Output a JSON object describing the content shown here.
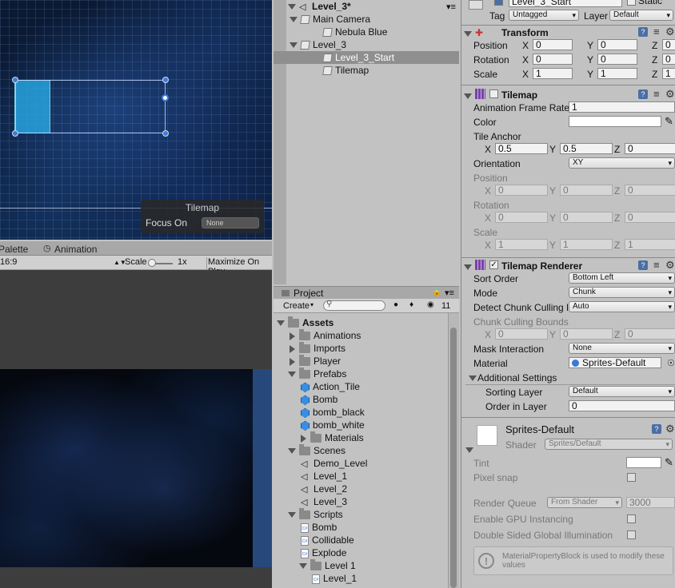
{
  "scene": {
    "overlay_title": "Tilemap",
    "focus_label": "Focus On",
    "focus_value": "None"
  },
  "bottom_tabs": {
    "palette": "Palette",
    "animation": "Animation"
  },
  "game_toolbar": {
    "aspect": "16:9",
    "scale_label": "Scale",
    "scale_value": "1x",
    "maximize": "Maximize On Play"
  },
  "hierarchy": {
    "items": [
      {
        "label": "Level_3*",
        "indent": 0,
        "icon": "unity-scene-icon",
        "expanded": true
      },
      {
        "label": "Main Camera",
        "indent": 1,
        "icon": "cube-icon",
        "expanded": true
      },
      {
        "label": "Nebula Blue",
        "indent": 2,
        "icon": "cube-icon"
      },
      {
        "label": "Level_3",
        "indent": 1,
        "icon": "cube-icon",
        "expanded": true
      },
      {
        "label": "Level_3_Start",
        "indent": 2,
        "icon": "cube-icon",
        "selected": true
      },
      {
        "label": "Tilemap",
        "indent": 2,
        "icon": "cube-icon"
      }
    ]
  },
  "project": {
    "tab": "Project",
    "create": "Create",
    "count": "11",
    "items": [
      {
        "label": "Assets",
        "indent": 0,
        "type": "folder",
        "state": "open"
      },
      {
        "label": "Animations",
        "indent": 1,
        "type": "folder",
        "state": "closed"
      },
      {
        "label": "Imports",
        "indent": 1,
        "type": "folder",
        "state": "closed"
      },
      {
        "label": "Player",
        "indent": 1,
        "type": "folder",
        "state": "closed"
      },
      {
        "label": "Prefabs",
        "indent": 1,
        "type": "folder",
        "state": "open"
      },
      {
        "label": "Action_Tile",
        "indent": 2,
        "type": "prefab"
      },
      {
        "label": "Bomb",
        "indent": 2,
        "type": "prefab"
      },
      {
        "label": "bomb_black",
        "indent": 2,
        "type": "prefab"
      },
      {
        "label": "bomb_white",
        "indent": 2,
        "type": "prefab"
      },
      {
        "label": "Materials",
        "indent": 2,
        "type": "folder",
        "state": "closed"
      },
      {
        "label": "Scenes",
        "indent": 1,
        "type": "folder",
        "state": "open"
      },
      {
        "label": "Demo_Level",
        "indent": 2,
        "type": "scene"
      },
      {
        "label": "Level_1",
        "indent": 2,
        "type": "scene"
      },
      {
        "label": "Level_2",
        "indent": 2,
        "type": "scene"
      },
      {
        "label": "Level_3",
        "indent": 2,
        "type": "scene"
      },
      {
        "label": "Scripts",
        "indent": 1,
        "type": "folder",
        "state": "open"
      },
      {
        "label": "Bomb",
        "indent": 2,
        "type": "script"
      },
      {
        "label": "Collidable",
        "indent": 2,
        "type": "script"
      },
      {
        "label": "Explode",
        "indent": 2,
        "type": "script"
      },
      {
        "label": "Level 1",
        "indent": 2,
        "type": "folder",
        "state": "open"
      },
      {
        "label": "Level_1",
        "indent": 3,
        "type": "script"
      }
    ]
  },
  "inspector": {
    "object_name": "Level_3_Start",
    "static": "Static",
    "tag_label": "Tag",
    "tag": "Untagged",
    "layer_label": "Layer",
    "layer": "Default",
    "transform": {
      "title": "Transform",
      "position_label": "Position",
      "rotation_label": "Rotation",
      "scale_label": "Scale",
      "position": [
        "0",
        "0",
        "0"
      ],
      "rotation": [
        "0",
        "0",
        "0"
      ],
      "scale": [
        "1",
        "1",
        "1"
      ]
    },
    "tilemap": {
      "title": "Tilemap",
      "frame_rate_label": "Animation Frame Rate",
      "frame_rate": "1",
      "color_label": "Color",
      "anchor_label": "Tile Anchor",
      "anchor": [
        "0.5",
        "0.5",
        "0"
      ],
      "orientation_label": "Orientation",
      "orientation": "XY",
      "position_label": "Position",
      "rotation_label": "Rotation",
      "scale_label": "Scale",
      "position": [
        "0",
        "0",
        "0"
      ],
      "rotation": [
        "0",
        "0",
        "0"
      ],
      "scale": [
        "1",
        "1",
        "1"
      ]
    },
    "renderer": {
      "title": "Tilemap Renderer",
      "sort_label": "Sort Order",
      "sort": "Bottom Left",
      "mode_label": "Mode",
      "mode": "Chunk",
      "culling_label": "Detect Chunk Culling B",
      "culling": "Auto",
      "bounds_label": "Chunk Culling Bounds",
      "bounds": [
        "0",
        "0",
        "0"
      ],
      "mask_label": "Mask Interaction",
      "mask": "None",
      "material_label": "Material",
      "material": "Sprites-Default",
      "additional": "Additional Settings",
      "sorting_layer_label": "Sorting Layer",
      "sorting_layer": "Default",
      "order_label": "Order in Layer",
      "order": "0"
    },
    "material": {
      "name": "Sprites-Default",
      "shader_label": "Shader",
      "shader": "Sprites/Default",
      "tint_label": "Tint",
      "pixel_snap_label": "Pixel snap",
      "render_queue_label": "Render Queue",
      "render_queue_mode": "From Shader",
      "render_queue": "3000",
      "gpu_label": "Enable GPU Instancing",
      "double_label": "Double Sided Global Illumination",
      "info": "MaterialPropertyBlock is used to modify these values"
    }
  },
  "axes": {
    "x": "X",
    "y": "Y",
    "z": "Z"
  }
}
